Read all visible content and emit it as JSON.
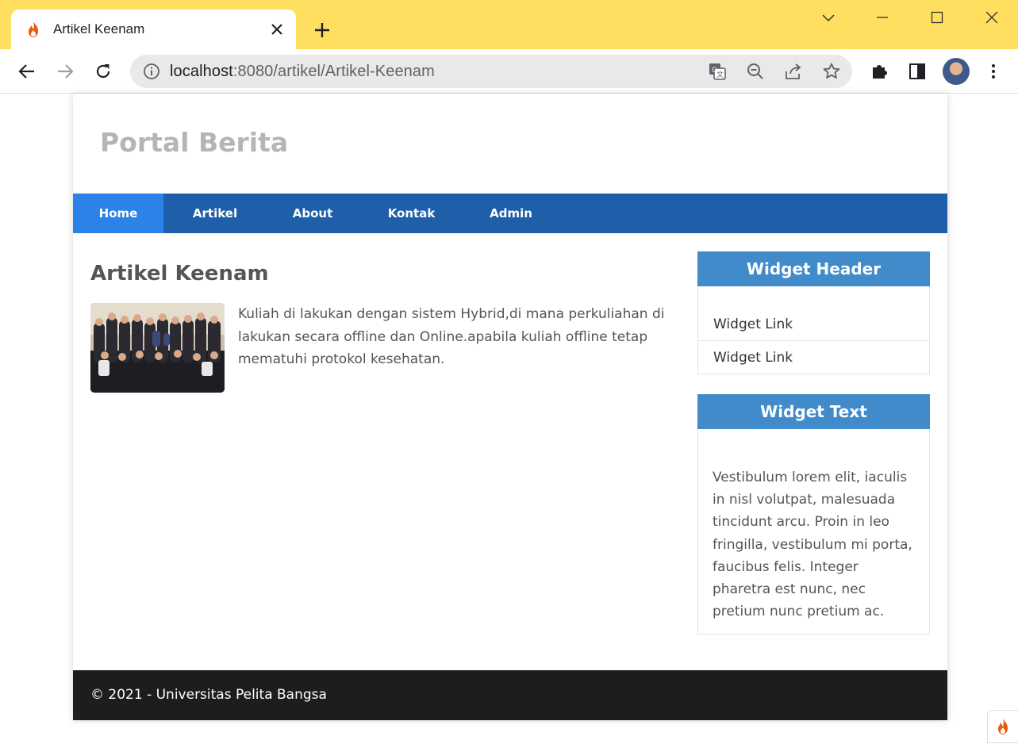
{
  "browser": {
    "tab_title": "Artikel Keenam",
    "url_host": "localhost",
    "url_rest": ":8080/artikel/Artikel-Keenam",
    "accent": "#ffdf5f"
  },
  "site": {
    "title": "Portal Berita",
    "nav": [
      "Home",
      "Artikel",
      "About",
      "Kontak",
      "Admin"
    ],
    "nav_active": "Home",
    "nav_color": "#1f5faa",
    "nav_active_color": "#2b83ea"
  },
  "article": {
    "title": "Artikel Keenam",
    "body": "Kuliah di lakukan dengan sistem Hybrid,di mana perkuliahan di lakukan secara offline dan Online.apabila kuliah offline tetap mematuhi protokol kesehatan.",
    "image": "group-photo"
  },
  "sidebar": {
    "widget1": {
      "header": "Widget Header",
      "links": [
        "Widget Link",
        "Widget Link"
      ]
    },
    "widget2": {
      "header": "Widget Text",
      "text": "Vestibulum lorem elit, iaculis in nisl volutpat, malesuada tincidunt arcu. Proin in leo fringilla, vestibulum mi porta, faucibus felis. Integer pharetra est nunc, nec pretium nunc pretium ac."
    },
    "header_color": "#428bca"
  },
  "footer": {
    "text": "© 2021 - Universitas Pelita Bangsa"
  }
}
